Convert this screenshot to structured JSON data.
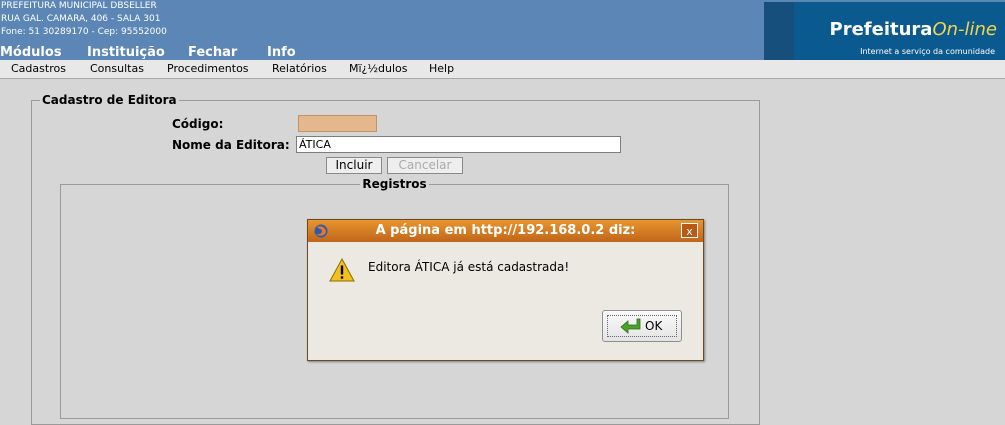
{
  "header": {
    "org_name": "PREFEITURA MUNICIPAL DBSELLER",
    "address": "RUA GAL. CAMARA, 406 - SALA 301",
    "contact": "Fone: 51 30289170  -  Cep: 95552000",
    "main_menu": [
      "Módulos",
      "Instituição",
      "Fechar",
      "Info"
    ],
    "logo": {
      "brand_bold": "Prefeitura",
      "brand_italic": "On-line",
      "tagline": "Internet a serviço da comunidade"
    }
  },
  "submenu": [
    "Cadastros",
    "Consultas",
    "Procedimentos",
    "Relatórios",
    "Mï¿½dulos",
    "Help"
  ],
  "form": {
    "legend": "Cadastro de Editora",
    "codigo_label": "Código:",
    "codigo_value": "",
    "nome_label": "Nome da Editora:",
    "nome_value": "ÁTICA",
    "incluir_label": "Incluir",
    "cancelar_label": "Cancelar",
    "registros_legend": "Registros"
  },
  "dialog": {
    "title": "A página em http://192.168.0.2 diz:",
    "close_label": "x",
    "message": "Editora ÁTICA já está cadastrada!",
    "ok_label": "OK"
  },
  "colors": {
    "header_bg": "#5b86b6",
    "logo_bg": "#0a5a8f",
    "page_bg": "#d6d6d6",
    "codigo_field_bg": "#e4b88c",
    "dialog_title_bg": "#d77a24"
  }
}
